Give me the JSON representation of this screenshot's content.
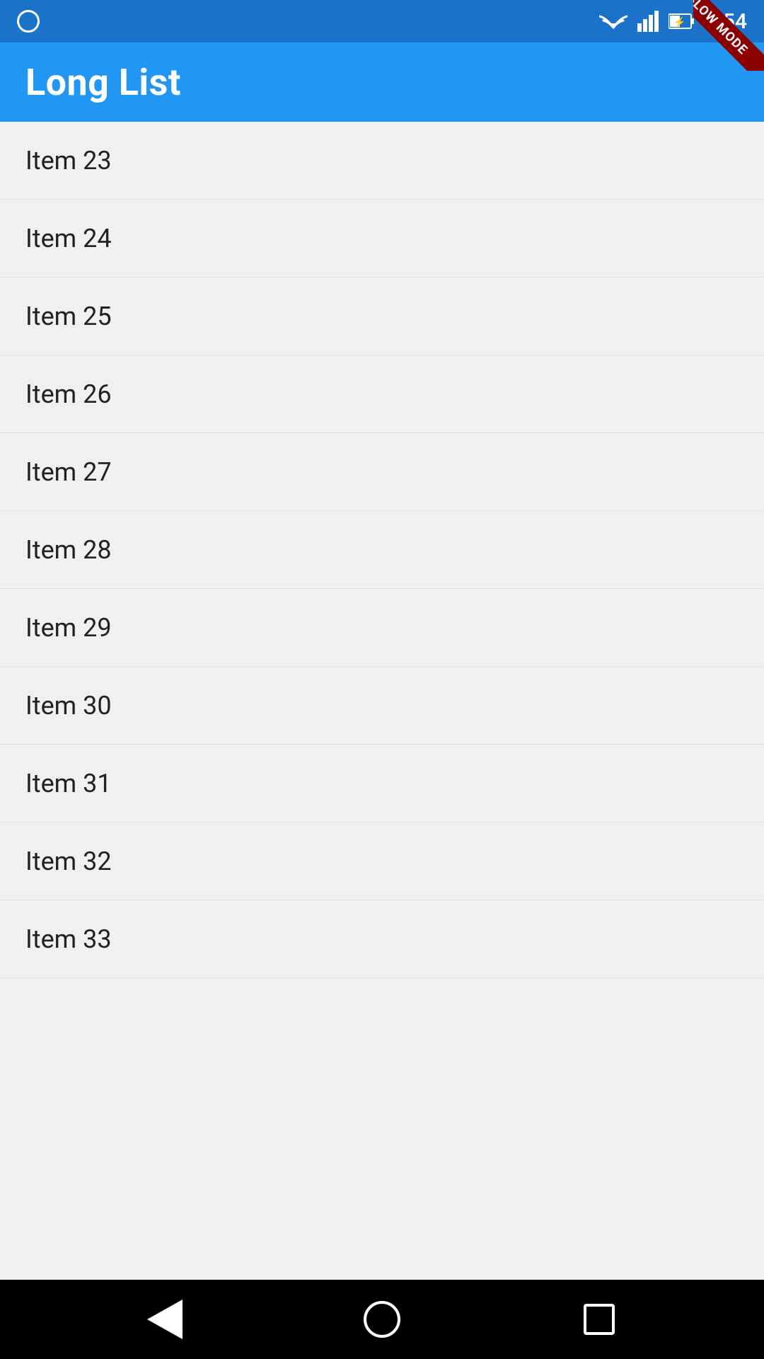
{
  "status_bar": {
    "time": "5:54",
    "slow_mode_label": "SLOW MODE"
  },
  "app_bar": {
    "title": "Long List"
  },
  "list": {
    "items": [
      {
        "label": "Item 23"
      },
      {
        "label": "Item 24"
      },
      {
        "label": "Item 25"
      },
      {
        "label": "Item 26"
      },
      {
        "label": "Item 27"
      },
      {
        "label": "Item 28"
      },
      {
        "label": "Item 29"
      },
      {
        "label": "Item 30"
      },
      {
        "label": "Item 31"
      },
      {
        "label": "Item 32"
      },
      {
        "label": "Item 33"
      }
    ]
  },
  "nav_bar": {
    "back_label": "Back",
    "home_label": "Home",
    "recents_label": "Recents"
  }
}
